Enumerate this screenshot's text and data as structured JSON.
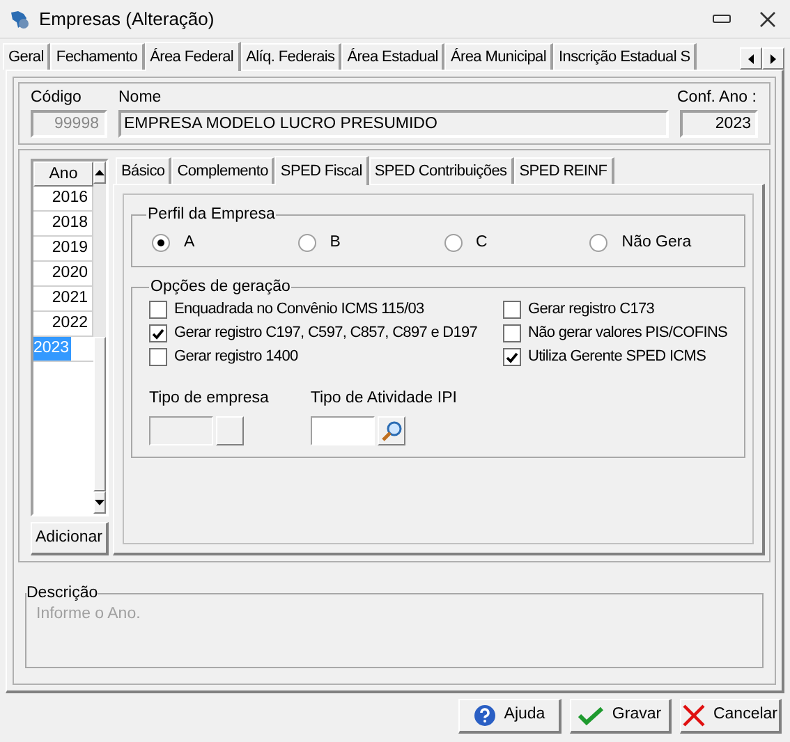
{
  "window": {
    "title": "Empresas (Alteração)"
  },
  "main_tabs": [
    {
      "label": "Geral",
      "selected": false
    },
    {
      "label": "Fechamento",
      "selected": false
    },
    {
      "label": "Área Federal",
      "selected": true
    },
    {
      "label": "Alíq. Federais",
      "selected": false
    },
    {
      "label": "Área Estadual",
      "selected": false
    },
    {
      "label": "Área Municipal",
      "selected": false
    },
    {
      "label": "Inscrição Estadual S",
      "selected": false
    }
  ],
  "header": {
    "codigo": {
      "label": "Código",
      "value": "99998"
    },
    "nome": {
      "label": "Nome",
      "value": "EMPRESA MODELO LUCRO PRESUMIDO"
    },
    "conf_ano": {
      "label": "Conf. Ano :",
      "value": "2023"
    }
  },
  "year_list": {
    "header": "Ano",
    "items": [
      {
        "label": "2016",
        "selected": false
      },
      {
        "label": "2018",
        "selected": false
      },
      {
        "label": "2019",
        "selected": false
      },
      {
        "label": "2020",
        "selected": false
      },
      {
        "label": "2021",
        "selected": false
      },
      {
        "label": "2022",
        "selected": false
      },
      {
        "label": "2023",
        "selected": true
      }
    ],
    "add_button": "Adicionar"
  },
  "sub_tabs": [
    {
      "label": "Básico",
      "selected": false
    },
    {
      "label": "Complemento",
      "selected": false
    },
    {
      "label": "SPED Fiscal",
      "selected": true
    },
    {
      "label": "SPED Contribuições",
      "selected": false
    },
    {
      "label": "SPED REINF",
      "selected": false
    }
  ],
  "perfil": {
    "title": "Perfil da Empresa",
    "options": [
      {
        "label": "A",
        "selected": true
      },
      {
        "label": "B",
        "selected": false
      },
      {
        "label": "C",
        "selected": false
      },
      {
        "label": "Não Gera",
        "selected": false
      }
    ]
  },
  "opcoes": {
    "title": "Opções de geração",
    "left": [
      {
        "label": "Enquadrada no Convênio ICMS 115/03",
        "checked": false
      },
      {
        "label": "Gerar registro C197, C597, C857, C897 e D197",
        "checked": true
      },
      {
        "label": "Gerar registro 1400",
        "checked": false
      }
    ],
    "right": [
      {
        "label": "Gerar registro C173",
        "checked": false
      },
      {
        "label": "Não gerar valores PIS/COFINS",
        "checked": false
      },
      {
        "label": "Utiliza Gerente SPED ICMS",
        "checked": true
      }
    ],
    "tipo_empresa": {
      "label": "Tipo de empresa"
    },
    "tipo_atividade": {
      "label": "Tipo de Atividade IPI"
    }
  },
  "descricao": {
    "title": "Descrição",
    "text": "Informe o Ano."
  },
  "buttons": [
    {
      "label": "Ajuda",
      "kind": "help"
    },
    {
      "label": "Gravar",
      "kind": "save"
    },
    {
      "label": "Cancelar",
      "kind": "cancel"
    }
  ]
}
